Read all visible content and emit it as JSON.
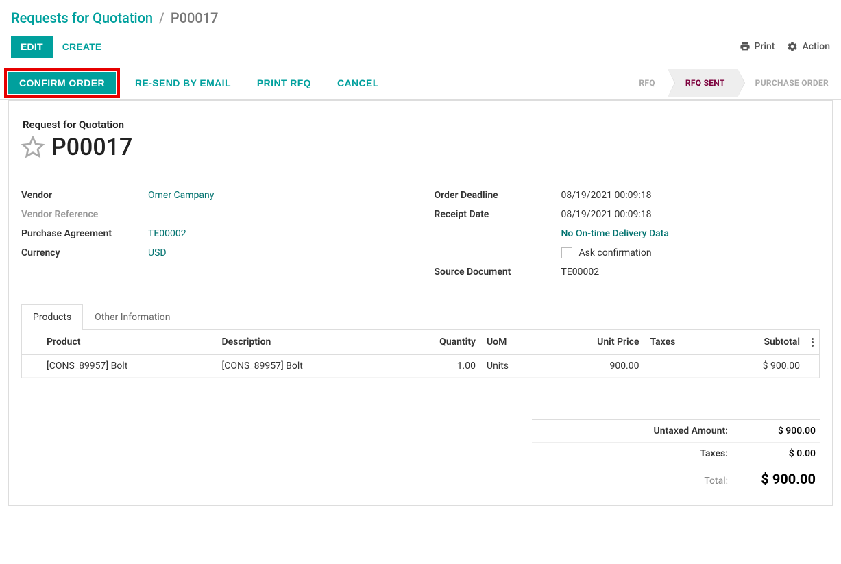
{
  "breadcrumb": {
    "parent": "Requests for Quotation",
    "separator": "/",
    "current": "P00017"
  },
  "topactions": {
    "edit": "EDIT",
    "create": "CREATE",
    "print": "Print",
    "action": "Action"
  },
  "statusbar": {
    "confirm": "CONFIRM ORDER",
    "resend": "RE-SEND BY EMAIL",
    "printrfq": "PRINT RFQ",
    "cancel": "CANCEL",
    "stages": {
      "rfq": "RFQ",
      "rfq_sent": "RFQ SENT",
      "po": "PURCHASE ORDER"
    }
  },
  "sheet": {
    "subtitle": "Request for Quotation",
    "title": "P00017"
  },
  "fields_left": {
    "vendor_label": "Vendor",
    "vendor_value": "Omer Campany",
    "vendor_ref_label": "Vendor Reference",
    "vendor_ref_value": "",
    "pa_label": "Purchase Agreement",
    "pa_value": "TE00002",
    "currency_label": "Currency",
    "currency_value": "USD"
  },
  "fields_right": {
    "deadline_label": "Order Deadline",
    "deadline_value": "08/19/2021 00:09:18",
    "receipt_label": "Receipt Date",
    "receipt_value": "08/19/2021 00:09:18",
    "no_ontime": "No On-time Delivery Data",
    "ask_conf": "Ask confirmation",
    "source_label": "Source Document",
    "source_value": "TE00002"
  },
  "tabs": {
    "products": "Products",
    "other": "Other Information"
  },
  "table": {
    "headers": {
      "product": "Product",
      "description": "Description",
      "qty": "Quantity",
      "uom": "UoM",
      "unit_price": "Unit Price",
      "taxes": "Taxes",
      "subtotal": "Subtotal"
    },
    "rows": [
      {
        "product": "[CONS_89957] Bolt",
        "description": "[CONS_89957] Bolt",
        "qty": "1.00",
        "uom": "Units",
        "unit_price": "900.00",
        "taxes": "",
        "subtotal": "$ 900.00"
      }
    ]
  },
  "totals": {
    "untaxed_label": "Untaxed Amount:",
    "untaxed_value": "$ 900.00",
    "taxes_label": "Taxes:",
    "taxes_value": "$ 0.00",
    "total_label": "Total:",
    "total_value": "$ 900.00"
  }
}
